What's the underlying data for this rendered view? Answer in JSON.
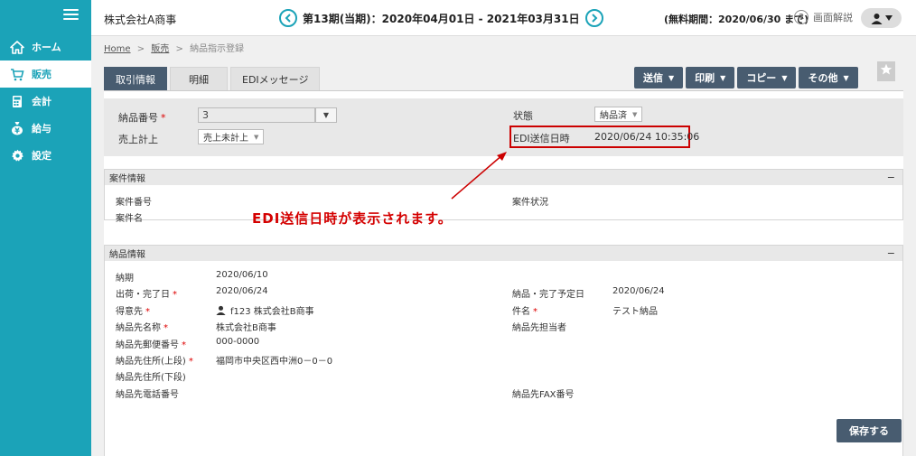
{
  "sidebar": {
    "items": [
      {
        "label": "ホーム",
        "icon": "home-icon"
      },
      {
        "label": "販売",
        "icon": "cart-icon"
      },
      {
        "label": "会計",
        "icon": "calculator-icon"
      },
      {
        "label": "給与",
        "icon": "money-bag-icon"
      },
      {
        "label": "設定",
        "icon": "gear-icon"
      }
    ],
    "active_index": 1
  },
  "header": {
    "company": "株式会社A商事",
    "period": "第13期(当期)：2020年04月01日 - 2021年03月31日",
    "free_period": "(無料期間：2020/06/30 まで)",
    "help_label": "画面解説"
  },
  "breadcrumb": {
    "home": "Home",
    "sales": "販売",
    "current": "納品指示登録",
    "separator": ">"
  },
  "tabs": [
    "取引情報",
    "明細",
    "EDIメッセージ"
  ],
  "actions": [
    "送信",
    "印刷",
    "コピー",
    "その他"
  ],
  "trade": {
    "delivery_no_label": "納品番号",
    "delivery_no_value": "3",
    "sales_record_label": "売上計上",
    "sales_record_value": "売上未計上",
    "status_label": "状態",
    "status_value": "納品済",
    "edi_sent_label": "EDI送信日時",
    "edi_sent_value": "2020/06/24 10:35:06"
  },
  "case_info": {
    "title": "案件情報",
    "case_no_label": "案件番号",
    "case_name_label": "案件名",
    "case_status_label": "案件状況"
  },
  "annotation": "EDI送信日時が表示されます。",
  "delivery_info": {
    "title": "納品情報",
    "left": [
      {
        "label": "納期",
        "required": false,
        "value": "2020/06/10"
      },
      {
        "label": "出荷・完了日",
        "required": true,
        "value": "2020/06/24"
      },
      {
        "label": "得意先",
        "required": true,
        "value": "f123 株式会社B商事"
      },
      {
        "label": "納品先名称",
        "required": true,
        "value": "株式会社B商事"
      },
      {
        "label": "納品先郵便番号",
        "required": true,
        "value": "000-0000"
      },
      {
        "label": "納品先住所(上段)",
        "required": true,
        "value": "福岡市中央区西中洲0－0－0"
      },
      {
        "label": "納品先住所(下段)",
        "required": false,
        "value": ""
      },
      {
        "label": "納品先電話番号",
        "required": false,
        "value": ""
      }
    ],
    "right": [
      {
        "label": "納品・完了予定日",
        "required": false,
        "value": "2020/06/24",
        "row": 1
      },
      {
        "label": "件名",
        "required": true,
        "value": "テスト納品",
        "row": 2
      },
      {
        "label": "納品先担当者",
        "required": false,
        "value": "",
        "row": 3
      },
      {
        "label": "納品先FAX番号",
        "required": false,
        "value": "",
        "row": 7
      }
    ]
  },
  "save_label": "保存する",
  "colors": {
    "sidebar": "#1ba3b8",
    "button": "#485c70",
    "annotation": "#d40000"
  }
}
